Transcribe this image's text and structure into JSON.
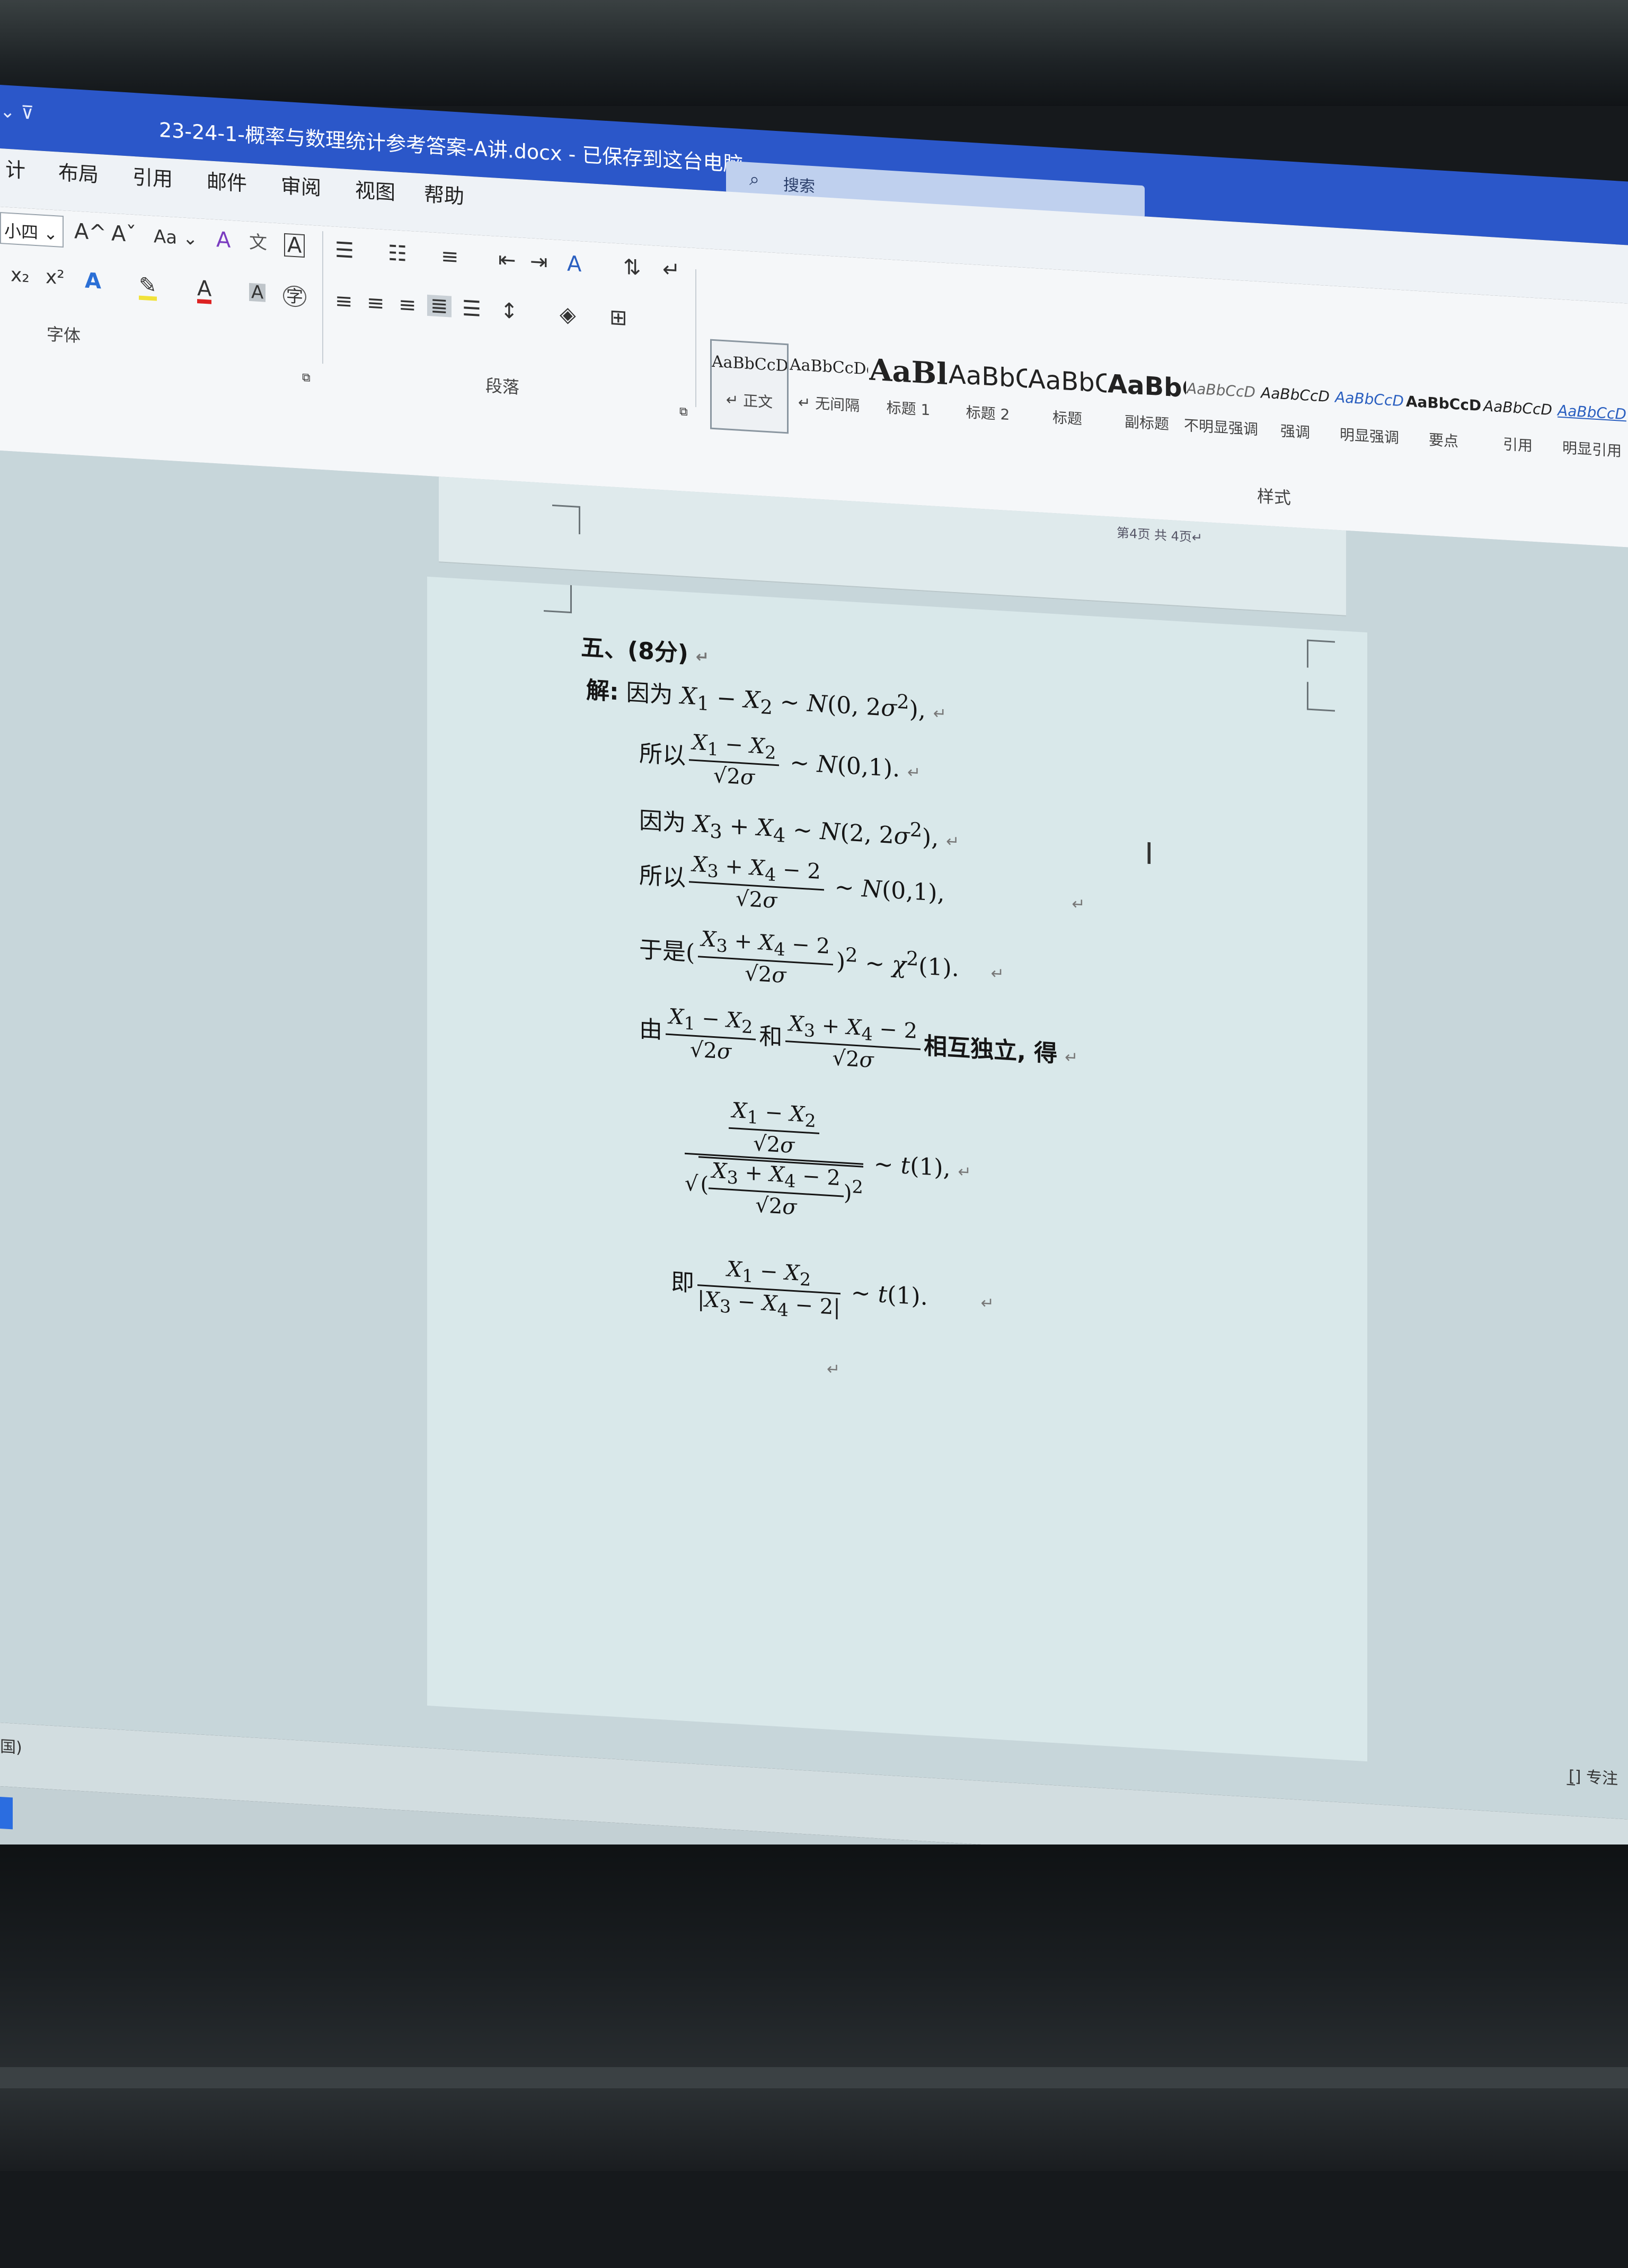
{
  "window": {
    "title": "23-24-1-概率与数理统计参考答案-A讲.docx  -  已保存到这台电脑 ⌄",
    "qat": "⌄  ⊽",
    "search_placeholder": "搜索"
  },
  "ribbon_tabs": [
    "计",
    "布局",
    "引用",
    "邮件",
    "审阅",
    "视图",
    "帮助"
  ],
  "font_group": {
    "font_size": "小四 ⌄",
    "grow": "A^",
    "shrink": "Aˇ",
    "change_case": "Aa ⌄",
    "clear_format": "A",
    "phonetic": "文",
    "border_char": "A",
    "subscript": "x₂",
    "superscript": "x²",
    "text_effect": "A",
    "highlight": "✎",
    "font_color": "A",
    "shading": "A",
    "enclose": "字",
    "label": "字体"
  },
  "paragraph_group": {
    "label": "段落"
  },
  "styles_group": {
    "label": "样式",
    "items": [
      {
        "preview": "AaBbCcDd",
        "name": "↵ 正文"
      },
      {
        "preview": "AaBbCcDd",
        "name": "↵ 无间隔"
      },
      {
        "preview": "AaBl",
        "name": "标题 1"
      },
      {
        "preview": "AaBbC",
        "name": "标题 2"
      },
      {
        "preview": "AaBbC",
        "name": "标题"
      },
      {
        "preview": "AaBbC",
        "name": "副标题"
      },
      {
        "preview": "AaBbCcD",
        "name": "不明显强调"
      },
      {
        "preview": "AaBbCcD",
        "name": "强调"
      },
      {
        "preview": "AaBbCcD",
        "name": "明显强调"
      },
      {
        "preview": "AaBbCcD",
        "name": "要点"
      },
      {
        "preview": "AaBbCcD",
        "name": "引用"
      },
      {
        "preview": "AaBbCcD",
        "name": "明显引用"
      }
    ]
  },
  "document": {
    "prev_footer": "第4页 共 4页↵",
    "heading": "五、(8分)",
    "solution_label": "解:",
    "line1_prefix": "因为",
    "line2_prefix": "所以",
    "line3_prefix": "因为",
    "line4_prefix": "所以",
    "line5_prefix": "于是",
    "line6_prefix": "由",
    "line6_and": "和",
    "line6_suffix": "相互独立, 得",
    "line8_prefix": "即",
    "return_mark": "↵"
  },
  "status": {
    "left": "国)",
    "focus": "[̲] 专注"
  }
}
